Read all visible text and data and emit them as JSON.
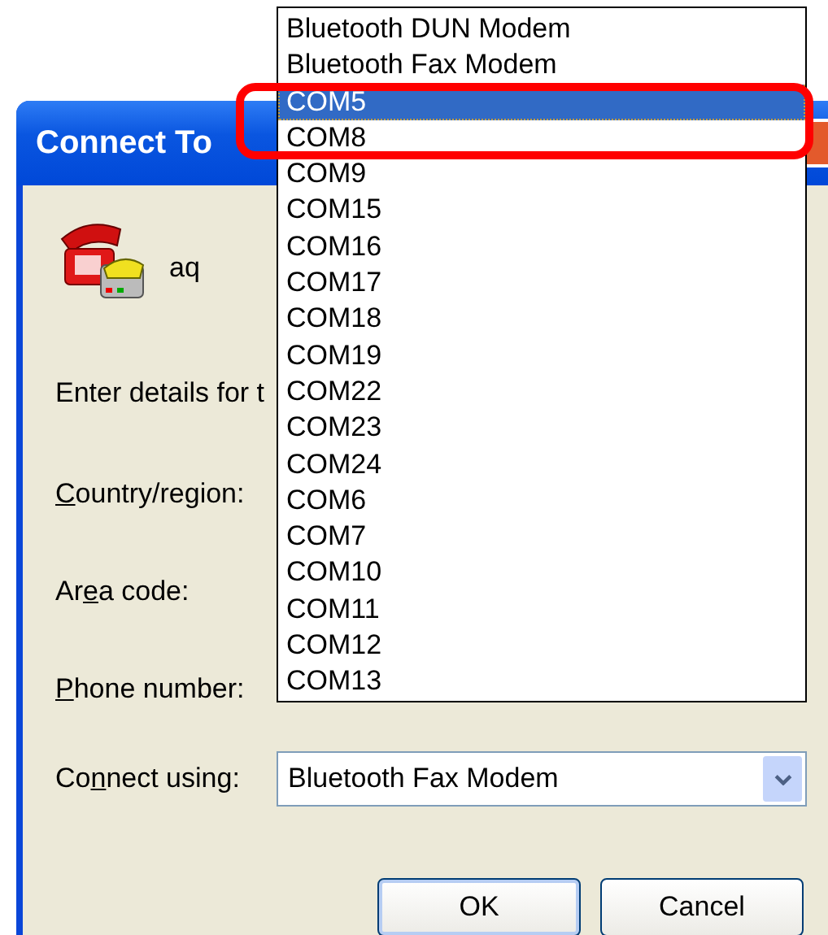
{
  "window": {
    "title": "Connect To"
  },
  "connection": {
    "name": "aq"
  },
  "instruction": "Enter details for t",
  "fields": [
    {
      "key": "C",
      "after": "ountry/region:"
    },
    {
      "before": "Ar",
      "key": "e",
      "after": "a code:"
    },
    {
      "key": "P",
      "after": "hone number:"
    }
  ],
  "connect_using": {
    "before": "Co",
    "key": "n",
    "after": "nect using:",
    "value": "Bluetooth Fax Modem",
    "expanded": true
  },
  "dropdown_items": [
    {
      "label": "Bluetooth DUN Modem",
      "selected": false
    },
    {
      "label": "Bluetooth Fax Modem",
      "selected": false
    },
    {
      "label": "COM5",
      "selected": true
    },
    {
      "label": "COM8",
      "selected": false
    },
    {
      "label": "COM9",
      "selected": false
    },
    {
      "label": "COM15",
      "selected": false
    },
    {
      "label": "COM16",
      "selected": false
    },
    {
      "label": "COM17",
      "selected": false
    },
    {
      "label": "COM18",
      "selected": false
    },
    {
      "label": "COM19",
      "selected": false
    },
    {
      "label": "COM22",
      "selected": false
    },
    {
      "label": "COM23",
      "selected": false
    },
    {
      "label": "COM24",
      "selected": false
    },
    {
      "label": "COM6",
      "selected": false
    },
    {
      "label": "COM7",
      "selected": false
    },
    {
      "label": "COM10",
      "selected": false
    },
    {
      "label": "COM11",
      "selected": false
    },
    {
      "label": "COM12",
      "selected": false
    },
    {
      "label": "COM13",
      "selected": false
    }
  ],
  "buttons": [
    {
      "label": "OK",
      "kind": "default"
    },
    {
      "label": "Cancel",
      "kind": "normal"
    }
  ]
}
